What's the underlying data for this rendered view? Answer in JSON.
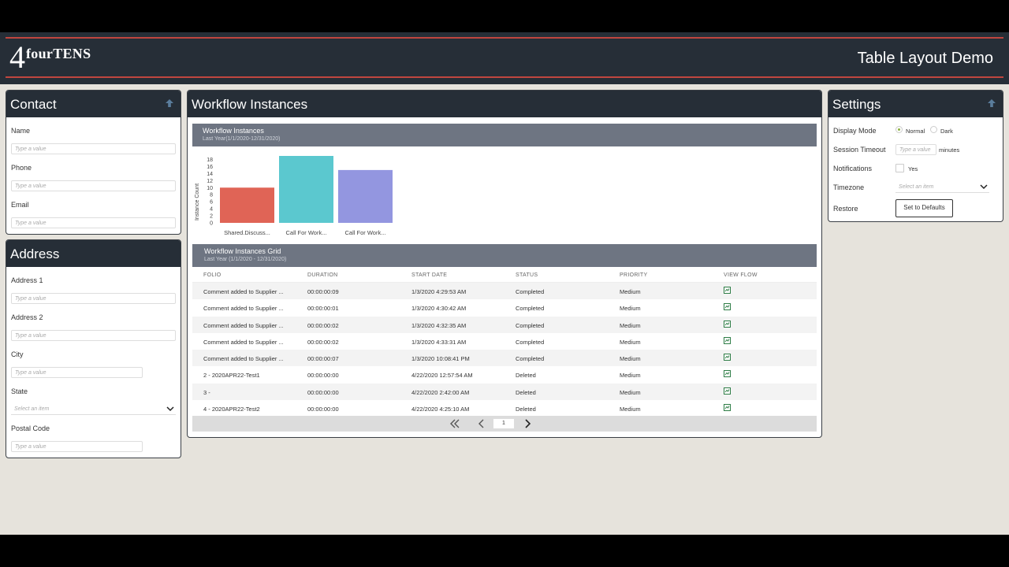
{
  "header": {
    "logo_num": "4",
    "logo_text": "fourTENS",
    "title": "Table Layout Demo"
  },
  "contact": {
    "title": "Contact",
    "fields": [
      {
        "label": "Name",
        "placeholder": "Type a value"
      },
      {
        "label": "Phone",
        "placeholder": "Type a value"
      },
      {
        "label": "Email",
        "placeholder": "Type a value"
      }
    ]
  },
  "address": {
    "title": "Address",
    "address1_label": "Address 1",
    "address2_label": "Address 2",
    "city_label": "City",
    "state_label": "State",
    "postal_label": "Postal Code",
    "placeholder": "Type a value",
    "select_placeholder": "Select an item"
  },
  "workflow": {
    "title": "Workflow Instances",
    "chart_title": "Workflow Instances",
    "chart_subtitle": "Last Year(1/1/2020-12/31/2020)",
    "grid_title": "Workflow Instances Grid",
    "grid_subtitle": "Last Year (1/1/2020 - 12/31/2020)",
    "columns": [
      "FOLIO",
      "DURATION",
      "START DATE",
      "STATUS",
      "PRIORITY",
      "VIEW FLOW"
    ],
    "rows": [
      [
        "Comment added to Supplier ...",
        "00:00:00:09",
        "1/3/2020 4:29:53 AM",
        "Completed",
        "Medium"
      ],
      [
        "Comment added to Supplier ...",
        "00:00:00:01",
        "1/3/2020 4:30:42 AM",
        "Completed",
        "Medium"
      ],
      [
        "Comment added to Supplier ...",
        "00:00:00:02",
        "1/3/2020 4:32:35 AM",
        "Completed",
        "Medium"
      ],
      [
        "Comment added to Supplier ...",
        "00:00:00:02",
        "1/3/2020 4:33:31 AM",
        "Completed",
        "Medium"
      ],
      [
        "Comment added to Supplier ...",
        "00:00:00:07",
        "1/3/2020 10:08:41 PM",
        "Completed",
        "Medium"
      ],
      [
        "2 - 2020APR22-Test1",
        "00:00:00:00",
        "4/22/2020 12:57:54 AM",
        "Deleted",
        "Medium"
      ],
      [
        "3 -",
        "00:00:00:00",
        "4/22/2020 2:42:00 AM",
        "Deleted",
        "Medium"
      ],
      [
        "4 - 2020APR22-Test2",
        "00:00:00:00",
        "4/22/2020 4:25:10 AM",
        "Deleted",
        "Medium"
      ]
    ],
    "page": "1"
  },
  "chart_data": {
    "type": "bar",
    "categories": [
      "Shared.Discuss...",
      "Call For Work...",
      "Call For Work..."
    ],
    "values": [
      10,
      19,
      15
    ],
    "colors": [
      "#e06456",
      "#5bc8cf",
      "#9396e0"
    ],
    "ylabel": "Instance Count",
    "yticks": [
      0,
      2,
      4,
      6,
      8,
      10,
      12,
      14,
      16,
      18
    ],
    "ylim": [
      0,
      19
    ]
  },
  "settings": {
    "title": "Settings",
    "display_mode_label": "Display Mode",
    "mode_normal": "Normal",
    "mode_dark": "Dark",
    "session_timeout_label": "Session Timeout",
    "timeout_placeholder": "Type a value",
    "minutes": "minutes",
    "notifications_label": "Notifications",
    "notifications_yes": "Yes",
    "timezone_label": "Timezone",
    "timezone_placeholder": "Select an item",
    "restore_label": "Restore",
    "restore_button": "Set to Defaults"
  },
  "colors": {
    "header_bg": "#262e37",
    "accent_red": "#c0463f",
    "subhead_bg": "#6e7582"
  }
}
